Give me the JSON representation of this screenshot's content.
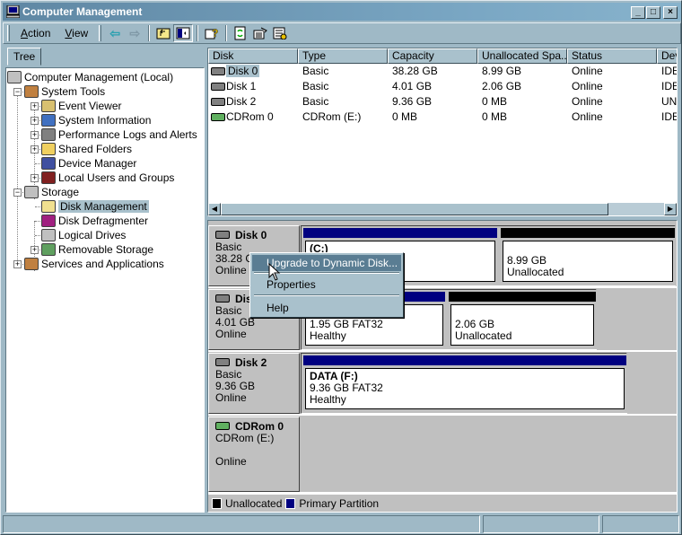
{
  "window": {
    "title": "Computer Management",
    "controls": {
      "minimize": "_",
      "maximize": "□",
      "close": "×"
    }
  },
  "toolbar": {
    "menus": [
      {
        "label": "Action",
        "accel": "A",
        "rest": "ction"
      },
      {
        "label": "View",
        "accel": "V",
        "rest": "iew"
      }
    ],
    "icons": [
      "back-arrow-icon",
      "forward-arrow-icon",
      "up-folder-icon",
      "show-hide-tree-icon",
      "help-icon",
      "refresh-icon",
      "properties-icon",
      "export-list-icon"
    ]
  },
  "tree": {
    "tab_label": "Tree",
    "nodes": [
      {
        "label": "Computer Management (Local)",
        "level": 0,
        "expander": ""
      },
      {
        "label": "System Tools",
        "level": 1,
        "expander": "−"
      },
      {
        "label": "Event Viewer",
        "level": 2,
        "expander": "+"
      },
      {
        "label": "System Information",
        "level": 2,
        "expander": "+"
      },
      {
        "label": "Performance Logs and Alerts",
        "level": 2,
        "expander": "+"
      },
      {
        "label": "Shared Folders",
        "level": 2,
        "expander": "+"
      },
      {
        "label": "Device Manager",
        "level": 2,
        "expander": ""
      },
      {
        "label": "Local Users and Groups",
        "level": 2,
        "expander": "+"
      },
      {
        "label": "Storage",
        "level": 1,
        "expander": "−"
      },
      {
        "label": "Disk Management",
        "level": 2,
        "expander": "",
        "selected": true
      },
      {
        "label": "Disk Defragmenter",
        "level": 2,
        "expander": ""
      },
      {
        "label": "Logical Drives",
        "level": 2,
        "expander": ""
      },
      {
        "label": "Removable Storage",
        "level": 2,
        "expander": "+"
      },
      {
        "label": "Services and Applications",
        "level": 1,
        "expander": "+"
      }
    ]
  },
  "disk_list": {
    "columns": [
      "Disk",
      "Type",
      "Capacity",
      "Unallocated Spa...",
      "Status",
      "Dev"
    ],
    "rows": [
      {
        "disk": "Disk 0",
        "type": "Basic",
        "capacity": "38.28 GB",
        "unallocated": "8.99 GB",
        "status": "Online",
        "device": "IDE",
        "selected": true
      },
      {
        "disk": "Disk 1",
        "type": "Basic",
        "capacity": "4.01 GB",
        "unallocated": "2.06 GB",
        "status": "Online",
        "device": "IDE"
      },
      {
        "disk": "Disk 2",
        "type": "Basic",
        "capacity": "9.36 GB",
        "unallocated": "0 MB",
        "status": "Online",
        "device": "UNI"
      },
      {
        "disk": "CDRom 0",
        "type": "CDRom (E:)",
        "capacity": "0 MB",
        "unallocated": "0 MB",
        "status": "Online",
        "device": "IDE"
      }
    ]
  },
  "disk_graph": {
    "disks": [
      {
        "name": "Disk 0",
        "type": "Basic",
        "size": "38.28 GB",
        "status": "Online",
        "partitions": [
          {
            "kind": "primary",
            "title": "(C:)",
            "line2": "",
            "line3": ""
          },
          {
            "kind": "unallocated",
            "title": "",
            "line2": "8.99 GB",
            "line3": "Unallocated"
          }
        ]
      },
      {
        "name": "Disk 1",
        "type": "Basic",
        "size": "4.01 GB",
        "status": "Online",
        "partitions": [
          {
            "kind": "primary",
            "title": "",
            "line2": "1.95 GB FAT32",
            "line3": "Healthy"
          },
          {
            "kind": "unallocated",
            "title": "",
            "line2": "2.06 GB",
            "line3": "Unallocated"
          }
        ]
      },
      {
        "name": "Disk 2",
        "type": "Basic",
        "size": "9.36 GB",
        "status": "Online",
        "partitions": [
          {
            "kind": "primary",
            "title": "DATA  (F:)",
            "line2": "9.36 GB FAT32",
            "line3": "Healthy"
          }
        ]
      },
      {
        "name": "CDRom 0",
        "type": "CDRom (E:)",
        "size": "",
        "status": "Online",
        "partitions": []
      }
    ],
    "legend": [
      {
        "label": "Unallocated",
        "color": "#000000"
      },
      {
        "label": "Primary Partition",
        "color": "#000080"
      }
    ]
  },
  "context_menu": {
    "items": [
      {
        "label": "Upgrade to Dynamic Disk...",
        "highlighted": true
      },
      {
        "label": "Properties"
      },
      {
        "label": "Help"
      }
    ]
  },
  "colors": {
    "primary_partition": "#000080",
    "unallocated": "#000000",
    "selection": "#a9c1cc",
    "menu_highlight": "#5a7d93"
  }
}
